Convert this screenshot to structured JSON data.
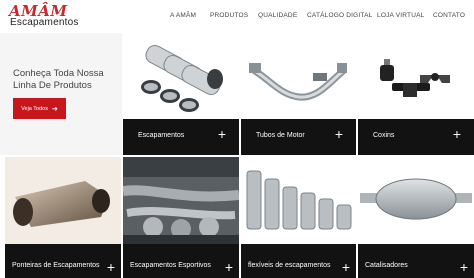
{
  "brand": {
    "logo_text": "AMÂM",
    "logo_sub": "Escapamentos"
  },
  "nav": [
    {
      "label": "A AMÂM"
    },
    {
      "label": "PRODUTOS"
    },
    {
      "label": "QUALIDADE"
    },
    {
      "label": "CATÁLOGO DIGITAL"
    },
    {
      "label": "LOJA VIRTUAL"
    },
    {
      "label": "CONTATO"
    }
  ],
  "intro": {
    "title": "Conheça Toda Nossa Linha De Produtos",
    "cta_label": "Veja Todos",
    "cta_icon": "arrow-right-icon"
  },
  "products": [
    {
      "label": "Escapamentos"
    },
    {
      "label": "Tubos de Motor"
    },
    {
      "label": "Coxins"
    },
    {
      "label": "Ponteiras de Escapamentos"
    },
    {
      "label": "Escapamentos Esportivos"
    },
    {
      "label": "flexíveis de escapamentos"
    },
    {
      "label": "Catalisadores"
    }
  ],
  "plus_symbol": "+",
  "colors": {
    "accent": "#c8161d",
    "bar": "#121212",
    "logo": "#c62a2a"
  }
}
